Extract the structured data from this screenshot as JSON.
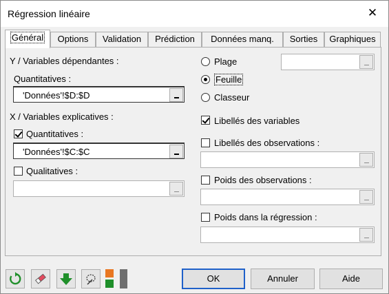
{
  "window": {
    "title": "Régression linéaire"
  },
  "tabs": [
    {
      "label": "Général",
      "active": true
    },
    {
      "label": "Options"
    },
    {
      "label": "Validation"
    },
    {
      "label": "Prédiction"
    },
    {
      "label": "Données manq."
    },
    {
      "label": "Sorties"
    },
    {
      "label": "Graphiques"
    }
  ],
  "left": {
    "y_section": "Y / Variables dépendantes :",
    "y_quant_label": "Quantitatives :",
    "y_quant_value": "'Données'!$D:$D",
    "x_section": "X / Variables explicatives :",
    "x_quant_label": "Quantitatives :",
    "x_quant_checked": true,
    "x_quant_value": "'Données'!$C:$C",
    "x_qual_label": "Qualitatives :",
    "x_qual_checked": false,
    "x_qual_value": ""
  },
  "right": {
    "output_options": [
      {
        "label": "Plage",
        "selected": false
      },
      {
        "label": "Feuille",
        "selected": true
      },
      {
        "label": "Classeur",
        "selected": false
      }
    ],
    "range_value": "",
    "var_labels": {
      "label": "Libellés des variables",
      "checked": true
    },
    "obs_labels": {
      "label": "Libellés des observations :",
      "checked": false,
      "value": ""
    },
    "obs_weights": {
      "label": "Poids des observations :",
      "checked": false,
      "value": ""
    },
    "reg_weights": {
      "label": "Poids dans la régression :",
      "checked": false,
      "value": ""
    }
  },
  "footer": {
    "ok": "OK",
    "cancel": "Annuler",
    "help": "Aide",
    "icons": [
      "reset-icon",
      "eraser-icon",
      "down-arrow-icon",
      "selection-icon",
      "layout-icon"
    ],
    "accent_colors": {
      "green": "#1f8f2a",
      "orange": "#e87722",
      "default_border": "#1e60c9"
    }
  }
}
